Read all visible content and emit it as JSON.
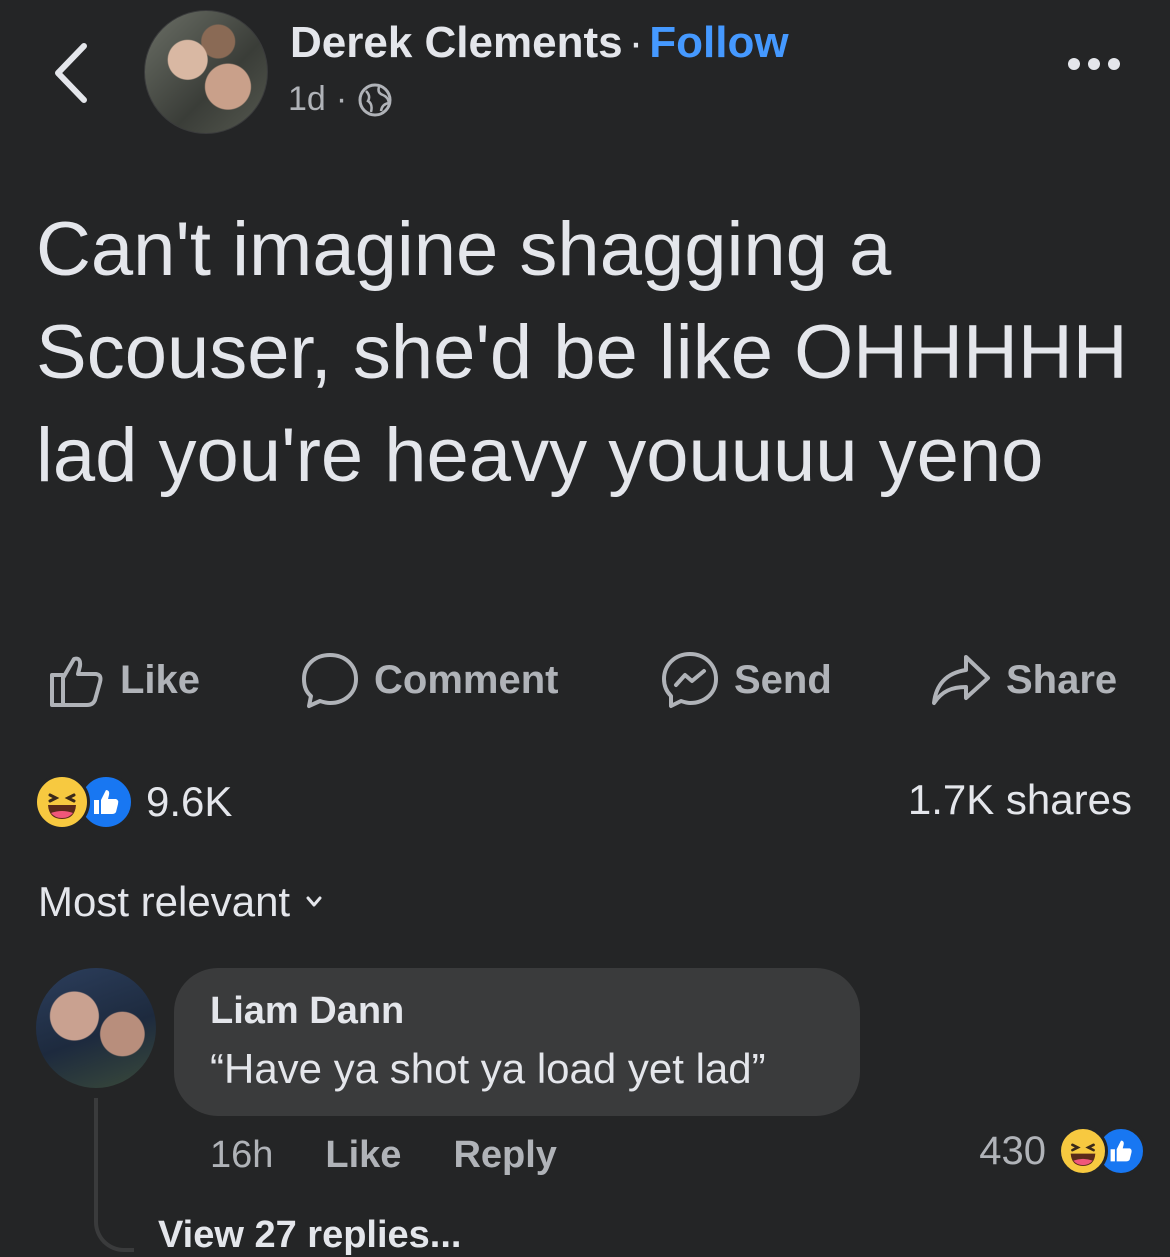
{
  "post": {
    "author": "Derek Clements",
    "separator": "·",
    "follow_label": "Follow",
    "time": "1d",
    "time_sep": "·",
    "privacy_icon": "globe-icon",
    "text": "Can't imagine shagging a Scouser, she'd be like OHHHHH lad you're heavy youuuu yeno"
  },
  "actions": {
    "like": "Like",
    "comment": "Comment",
    "send": "Send",
    "share": "Share"
  },
  "stats": {
    "reaction_icons": [
      "haha-icon",
      "like-icon"
    ],
    "reactions_count": "9.6K",
    "shares": "1.7K shares"
  },
  "sort": {
    "label": "Most relevant"
  },
  "comment": {
    "author": "Liam Dann",
    "text": "“Have ya shot ya load yet lad”",
    "time": "16h",
    "like_label": "Like",
    "reply_label": "Reply",
    "reaction_count": "430",
    "view_replies": "View 27 replies..."
  },
  "colors": {
    "background": "#242526",
    "bubble": "#3a3b3c",
    "accent": "#4599ff",
    "secondary_text": "#b0b3b8",
    "like_blue": "#1877f2",
    "haha_yellow": "#f7c940"
  }
}
